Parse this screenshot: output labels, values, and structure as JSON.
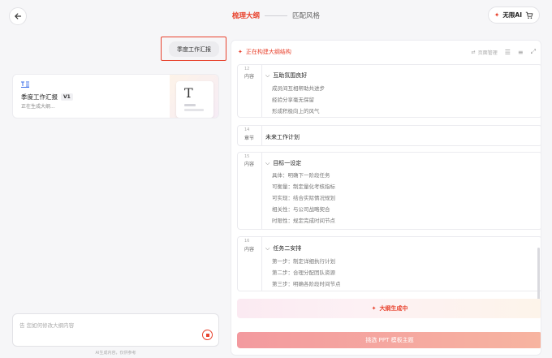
{
  "header": {
    "back_icon": "arrow-left-icon",
    "steps": [
      {
        "label": "梳理大纲",
        "active": true
      },
      {
        "label": "匹配风格",
        "active": false
      }
    ],
    "vip_label": "无限AI",
    "vip_icon": "sparkle-icon",
    "cart_icon": "cart-icon"
  },
  "chat": {
    "user_message": "季度工作汇报",
    "doc_card": {
      "icon": "outline-doc-icon",
      "title": "季度工作汇报",
      "version": "V1",
      "status": "正在生成大纲...",
      "thumb_letter": "T"
    },
    "input_placeholder": "告 您如何修改大纲内容",
    "ai_note": "AI生成内容，仅供参考"
  },
  "outline": {
    "status": "正在构建大纲结构",
    "toolbar": {
      "page_manage": "页面管理"
    },
    "blocks": [
      {
        "num": "12",
        "tag": "内容",
        "heading": "互助氛围良好",
        "lines": [
          "成员间互相帮助共进步",
          "经验分享毫无保留",
          "形成积极向上的风气"
        ]
      },
      {
        "num": "14",
        "tag": "章节",
        "heading": "未来工作计划",
        "lines": []
      },
      {
        "num": "15",
        "tag": "内容",
        "heading": "目标一设定",
        "lines": [
          "具体：明确下一阶段任务",
          "可衡量：制定量化考核指标",
          "可实现：结合实际情况规划",
          "相关性：与公司战略契合",
          "时限性：规定完成时间节点"
        ]
      },
      {
        "num": "16",
        "tag": "内容",
        "heading": "任务二安排",
        "lines": [
          "第一步：制定详细执行计划",
          "第二步：合理分配团队资源",
          "第三步：明确各阶段时间节点"
        ]
      }
    ],
    "generating_label": "大纲生成中",
    "cta_label": "挑选 PPT 模板主题"
  }
}
